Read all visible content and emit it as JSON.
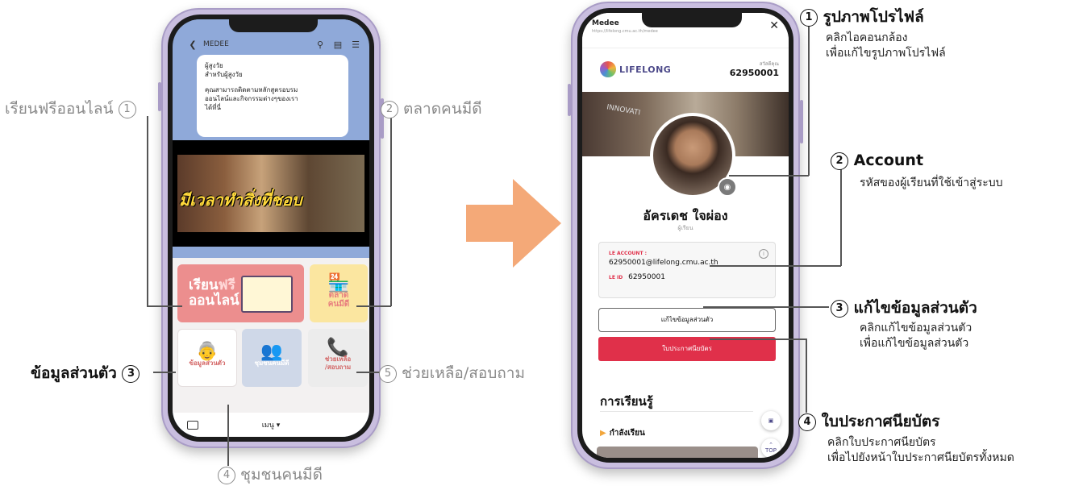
{
  "left_phone": {
    "app_title": "MEDEE",
    "chat_lines": [
      "ผู้สูงวัย",
      "สำหรับผู้สูงวัย",
      "คุณสามารถติดตามหลักสูตรอบรม",
      "ออนไลน์และกิจกรรมต่างๆของเรา",
      "ได้ที่นี่"
    ],
    "video_caption": "มีเวลาทำสิ่งที่ชอบ",
    "tiles": {
      "learn_line1": "เรียน",
      "learn_free": "ฟรี",
      "learn_line2": "ออนไลน์",
      "market_line1": "ตลาด",
      "market_line2": "คนมีดี",
      "personal": "ข้อมูลส่วนตัว",
      "community": "ชุมชนคนมีดี",
      "help_line1": "ช่วยเหลือ",
      "help_line2": "/สอบถาม"
    },
    "menu_label": "เมนู ▾"
  },
  "right_phone": {
    "window_title": "Medee",
    "url": "https://lifelong.cmu.ac.th/medee",
    "logo_text": "LIFELONG",
    "greeting": "สวัสดีคุณ",
    "account_number": "62950001",
    "banner_text": "INNOVATI",
    "name": "อัครเดช ใจผ่อง",
    "role": "ผู้เรียน",
    "account_label": "LE ACCOUNT :",
    "account_email": "62950001@lifelong.cmu.ac.th",
    "le_id_label": "LE ID",
    "le_id": "62950001",
    "edit_button": "แก้ไขข้อมูลส่วนตัว",
    "certificate_button": "ใบประกาศนียบัตร",
    "learning_title": "การเรียนรู้",
    "in_progress": "กำลังเรียน",
    "top_label": "TOP"
  },
  "annotations_left": {
    "n1": "1",
    "a1": "เรียนฟรีออนไลน์",
    "n2": "2",
    "a2": "ตลาดคนมีดี",
    "n3": "3",
    "a3": "ข้อมูลส่วนตัว",
    "n4": "4",
    "a4": "ชุมชนคนมีดี",
    "n5": "5",
    "a5": "ช่วยเหลือ/สอบถาม"
  },
  "annotations_right": {
    "n1": "1",
    "t1": "รูปภาพโปรไฟล์",
    "s1a": "คลิกไอคอนกล้อง",
    "s1b": "เพื่อแก้ไขรูปภาพโปรไฟล์",
    "n2": "2",
    "t2": "Account",
    "s2a": "รหัสของผู้เรียนที่ใช้เข้าสู่ระบบ",
    "n3": "3",
    "t3": "แก้ไขข้อมูลส่วนตัว",
    "s3a": "คลิกแก้ไขข้อมูลส่วนตัว",
    "s3b": "เพื่อแก้ไขข้อมูลส่วนตัว",
    "n4": "4",
    "t4": "ใบประกาศนียบัตร",
    "s4a": "คลิกใบประกาศนียบัตร",
    "s4b": "เพื่อไปยังหน้าใบประกาศนียบัตรทั้งหมด"
  },
  "colors": {
    "arrow": "#f4a978",
    "accent_red": "#e0304a",
    "chat_bg": "#8fa9d9"
  }
}
